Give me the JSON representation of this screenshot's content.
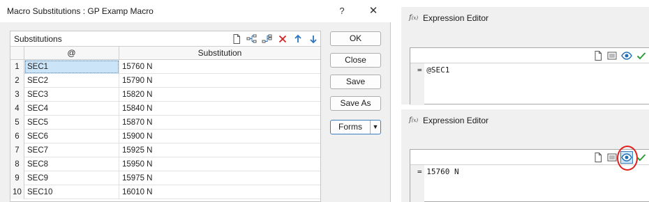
{
  "macro_dialog": {
    "title": "Macro Substitutions : GP Examp Macro",
    "help_label": "?",
    "close_label": "✕",
    "grid": {
      "header_title": "Substitutions",
      "toolbar_icons": [
        "new-icon",
        "insert-row-icon",
        "insert-after-icon",
        "delete-icon",
        "move-up-icon",
        "move-down-icon"
      ],
      "columns": [
        "@",
        "Substitution"
      ],
      "rows": [
        {
          "num": "1",
          "key": "SEC1",
          "value": "15760 N"
        },
        {
          "num": "2",
          "key": "SEC2",
          "value": "15790 N"
        },
        {
          "num": "3",
          "key": "SEC3",
          "value": "15820 N"
        },
        {
          "num": "4",
          "key": "SEC4",
          "value": "15840 N"
        },
        {
          "num": "5",
          "key": "SEC5",
          "value": "15870 N"
        },
        {
          "num": "6",
          "key": "SEC6",
          "value": "15900 N"
        },
        {
          "num": "7",
          "key": "SEC7",
          "value": "15925 N"
        },
        {
          "num": "8",
          "key": "SEC8",
          "value": "15950 N"
        },
        {
          "num": "9",
          "key": "SEC9",
          "value": "15975 N"
        },
        {
          "num": "10",
          "key": "SEC10",
          "value": "16010 N"
        }
      ],
      "selected_row": 1
    },
    "buttons": {
      "ok": "OK",
      "close": "Close",
      "save": "Save",
      "save_as": "Save As",
      "forms": "Forms",
      "forms_arrow": "▼"
    }
  },
  "expression_editor_1": {
    "title": "Expression Editor",
    "fx_label": "f",
    "fx_sub": "(x)",
    "toolbar_icons": [
      "new-icon",
      "list-icon",
      "eye-icon",
      "check-icon"
    ],
    "code": "= @SEC1"
  },
  "expression_editor_2": {
    "title": "Expression Editor",
    "fx_label": "f",
    "fx_sub": "(x)",
    "toolbar_icons": [
      "new-icon",
      "list-icon",
      "eye-icon",
      "check-icon"
    ],
    "code": "= 15760 N",
    "eye_highlighted": true
  },
  "colors": {
    "accent": "#2a74c0",
    "check": "#2e9b3a",
    "delete": "#d42020",
    "selection": "#cce4f7",
    "highlight_ring": "#e0201c"
  }
}
